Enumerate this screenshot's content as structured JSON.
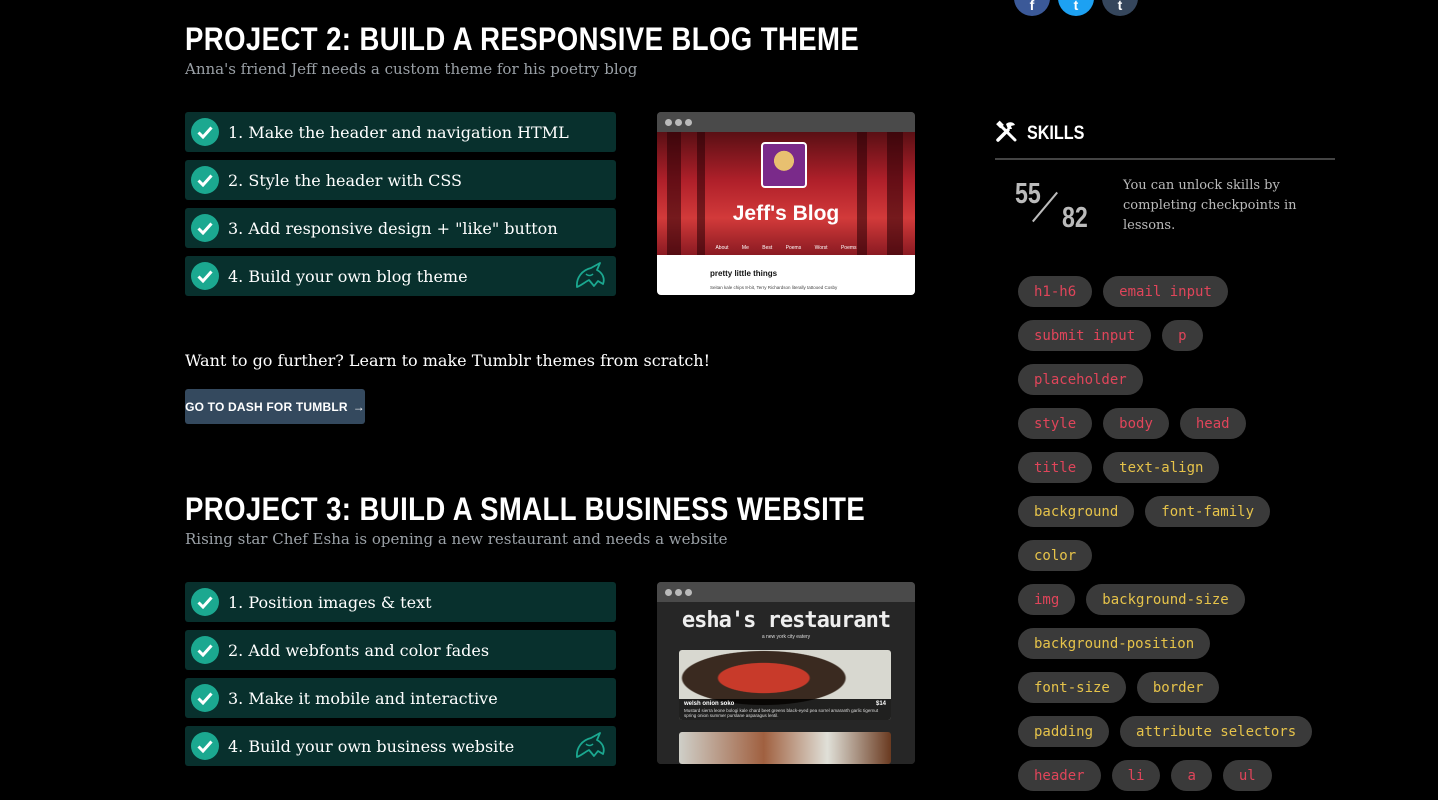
{
  "project2": {
    "title": "PROJECT 2: BUILD A RESPONSIVE BLOG THEME",
    "subtitle": "Anna's friend Jeff needs a custom theme for his poetry blog",
    "steps": [
      "1. Make the header and navigation HTML",
      "2. Style the header with CSS",
      "3. Add responsive design + \"like\" button",
      "4. Build your own blog theme"
    ],
    "preview": {
      "blog_title": "Jeff's Blog",
      "nav": "About Me   Best Poems   Worst Poems",
      "post_title": "pretty little things",
      "post_text": "Seitan kale chips 8-bit, Terry Richardson literally tattooed Cosby"
    }
  },
  "further": {
    "text": "Want to go further? Learn to make Tumblr themes from scratch!",
    "button_label": "GO TO DASH FOR TUMBLR",
    "button_arrow": "→"
  },
  "project3": {
    "title": "PROJECT 3: BUILD A SMALL BUSINESS WEBSITE",
    "subtitle": "Rising star Chef Esha is opening a new restaurant and needs a website",
    "steps": [
      "1. Position images & text",
      "2. Add webfonts and color fades",
      "3. Make it mobile and interactive",
      "4. Build your own business website"
    ],
    "preview": {
      "title": "esha's restaurant",
      "tagline": "a new york city eatery",
      "dish_name": "welsh onion soko",
      "dish_price": "$14",
      "dish_desc": "Mustard sierra leone bologi kale chard beet greens black-eyed pea sorrel amaranth garlic tigernut spring onion summer purslane asparagus lentil."
    }
  },
  "social": {
    "icons": [
      "facebook-icon",
      "twitter-icon",
      "tumblr-icon"
    ],
    "letters": [
      "f",
      "t",
      "t"
    ]
  },
  "skills": {
    "title": "SKILLS",
    "unlocked": "55",
    "total": "82",
    "note": "You can unlock skills by completing checkpoints in lessons.",
    "rows": [
      [
        {
          "label": "h1-h6",
          "unlocked": false
        },
        {
          "label": "email input",
          "unlocked": false
        }
      ],
      [
        {
          "label": "submit input",
          "unlocked": false
        },
        {
          "label": "p",
          "unlocked": false
        }
      ],
      [
        {
          "label": "placeholder",
          "unlocked": false
        }
      ],
      [
        {
          "label": "style",
          "unlocked": false
        },
        {
          "label": "body",
          "unlocked": false
        },
        {
          "label": "head",
          "unlocked": false
        }
      ],
      [
        {
          "label": "title",
          "unlocked": false
        },
        {
          "label": "text-align",
          "unlocked": true
        }
      ],
      [
        {
          "label": "background",
          "unlocked": true
        },
        {
          "label": "font-family",
          "unlocked": true
        }
      ],
      [
        {
          "label": "color",
          "unlocked": true
        }
      ],
      [
        {
          "label": "img",
          "unlocked": false
        },
        {
          "label": "background-size",
          "unlocked": true
        }
      ],
      [
        {
          "label": "background-position",
          "unlocked": true
        }
      ],
      [
        {
          "label": "font-size",
          "unlocked": true
        },
        {
          "label": "border",
          "unlocked": true
        }
      ],
      [
        {
          "label": "padding",
          "unlocked": true
        },
        {
          "label": "attribute selectors",
          "unlocked": true
        }
      ],
      [
        {
          "label": "header",
          "unlocked": false
        },
        {
          "label": "li",
          "unlocked": false
        },
        {
          "label": "a",
          "unlocked": false
        },
        {
          "label": "ul",
          "unlocked": false
        }
      ]
    ],
    "colors": {
      "locked": "#e0455a",
      "unlocked": "#e6c34a"
    }
  },
  "colors": {
    "step_bg": "#08302d",
    "check": "#1ba890",
    "button": "#34495e",
    "facebook": "#3b5998",
    "twitter": "#1da1f2",
    "tumblr": "#35465c"
  }
}
